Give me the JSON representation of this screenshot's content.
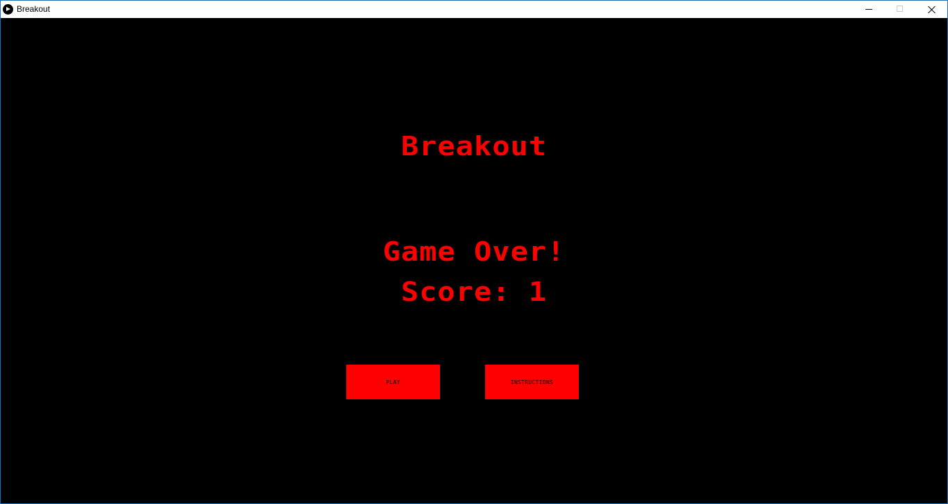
{
  "window": {
    "title": "Breakout",
    "controls": [
      "minimize",
      "maximize",
      "close"
    ]
  },
  "game": {
    "title": "Breakout",
    "status": "Game Over!",
    "score_text": "Score: 1",
    "buttons": {
      "play": "PLAY",
      "instructions": "INSTRUCTIONS"
    }
  },
  "colors": {
    "background": "#000000",
    "text": "#ff0000",
    "button_bg": "#ff0000",
    "button_text": "#000000"
  }
}
